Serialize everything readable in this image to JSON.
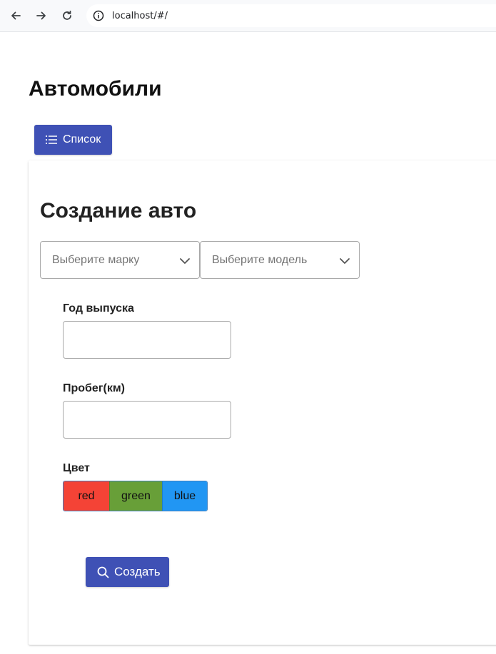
{
  "browser": {
    "url": "localhost/#/",
    "icons": [
      "back-arrow-icon",
      "forward-arrow-icon",
      "reload-icon",
      "info-icon"
    ]
  },
  "page": {
    "title": "Автомобили",
    "list_button_label": "Список",
    "list_button_icon": "list-icon"
  },
  "form": {
    "title": "Создание авто",
    "brand_select": {
      "placeholder": "Выберите марку"
    },
    "model_select": {
      "placeholder": "Выберите модель"
    },
    "year_label": "Год выпуска",
    "year_value": "",
    "mileage_label": "Пробег(км)",
    "mileage_value": "",
    "color_label": "Цвет",
    "colors": [
      {
        "label": "red",
        "hex": "#f44336"
      },
      {
        "label": "green",
        "hex": "#689f38"
      },
      {
        "label": "blue",
        "hex": "#2196f3"
      }
    ],
    "create_button_label": "Создать",
    "create_button_icon": "search-icon"
  },
  "theme": {
    "primary": "#3f51b5"
  }
}
